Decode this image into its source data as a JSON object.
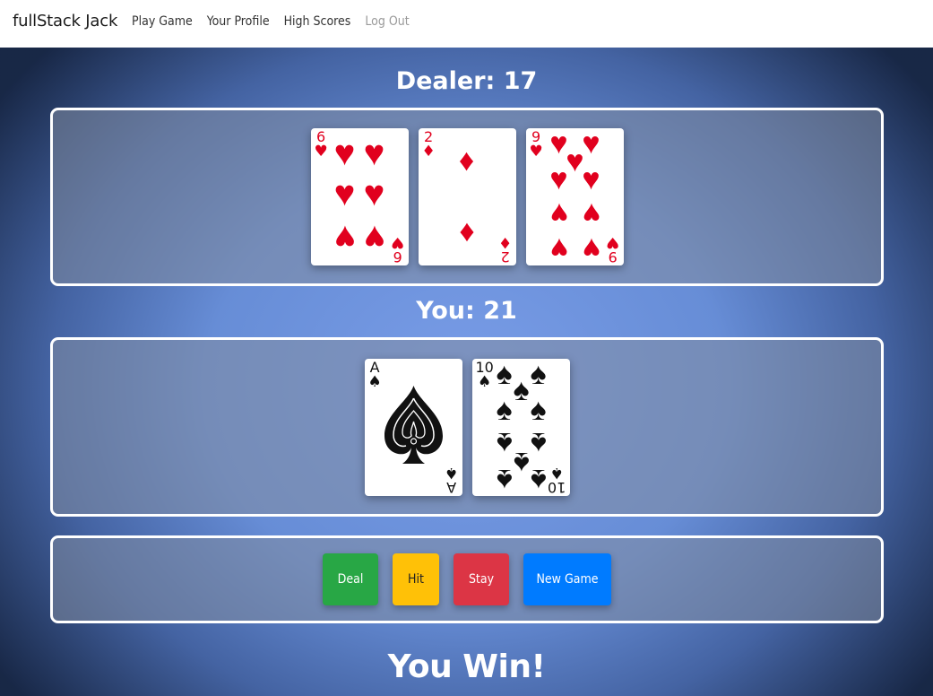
{
  "navbar": {
    "brand": "fullStack Jack",
    "links": [
      {
        "label": "Play Game"
      },
      {
        "label": "Your Profile"
      },
      {
        "label": "High Scores"
      },
      {
        "label": "Log Out"
      }
    ]
  },
  "game": {
    "dealer_label": "Dealer: 17",
    "player_label": "You: 21",
    "result": "You Win!",
    "dealer_cards": [
      {
        "rank": "6",
        "suit": "hearts",
        "suit_glyph": "♥",
        "color": "#e1001e"
      },
      {
        "rank": "2",
        "suit": "diamonds",
        "suit_glyph": "♦",
        "color": "#e1001e"
      },
      {
        "rank": "9",
        "suit": "hearts",
        "suit_glyph": "♥",
        "color": "#e1001e"
      }
    ],
    "player_cards": [
      {
        "rank": "A",
        "suit": "spades",
        "suit_glyph": "♠",
        "color": "#111111"
      },
      {
        "rank": "10",
        "suit": "spades",
        "suit_glyph": "♠",
        "color": "#111111"
      }
    ]
  },
  "controls": {
    "deal": "Deal",
    "hit": "Hit",
    "stay": "Stay",
    "new_game": "New Game"
  },
  "colors": {
    "deal": "#28a745",
    "hit": "#ffc107",
    "stay": "#dc3545",
    "new_game": "#007bff"
  }
}
